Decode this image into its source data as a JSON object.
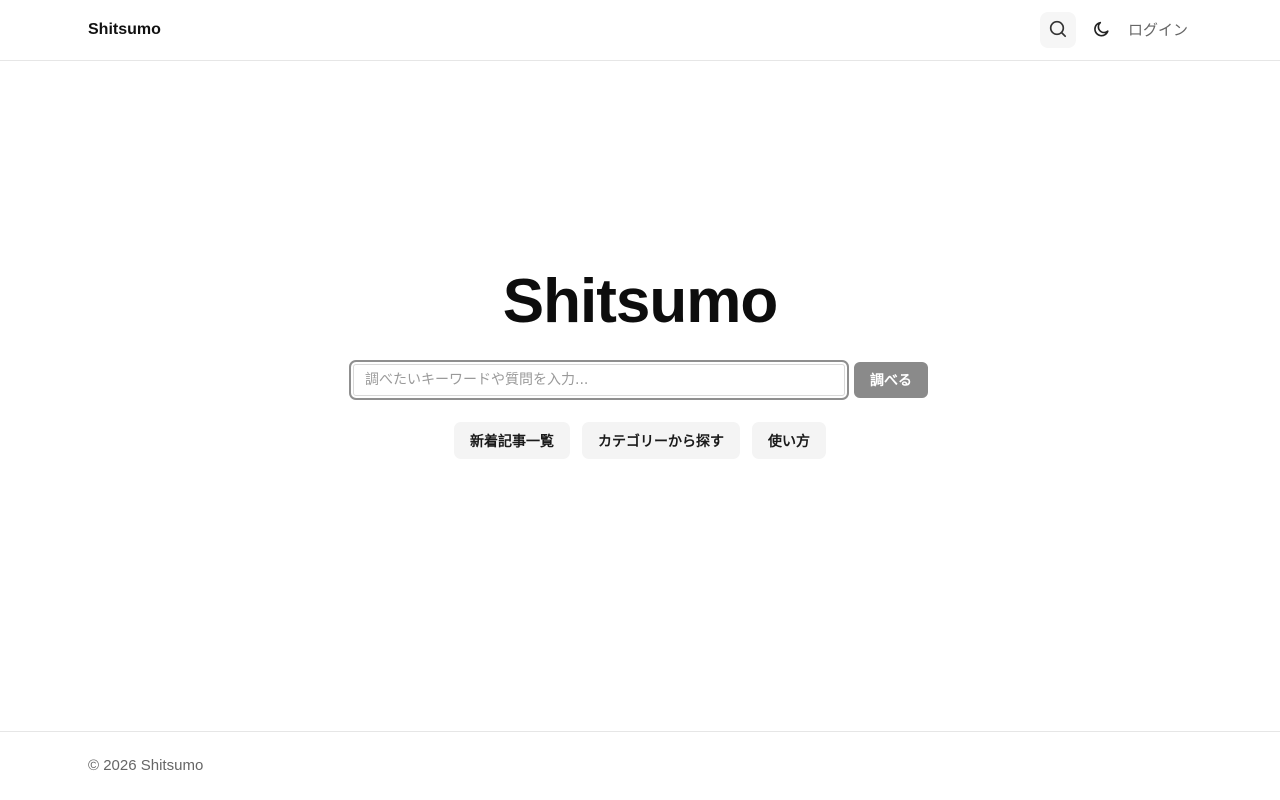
{
  "header": {
    "brand": "Shitsumo",
    "search_icon": "search-icon",
    "theme_icon": "moon-icon",
    "login_label": "ログイン"
  },
  "hero": {
    "title": "Shitsumo",
    "search": {
      "placeholder": "調べたいキーワードや質問を入力...",
      "value": "",
      "submit_label": "調べる"
    },
    "quick_links": [
      {
        "label": "新着記事一覧"
      },
      {
        "label": "カテゴリーから探す"
      },
      {
        "label": "使い方"
      }
    ]
  },
  "footer": {
    "copyright": "© 2026 Shitsumo"
  },
  "colors": {
    "text": "#111111",
    "muted": "#666666",
    "button_gray": "#8a8a8a",
    "chip_bg": "#f4f4f4",
    "border": "#e6e6e6"
  }
}
